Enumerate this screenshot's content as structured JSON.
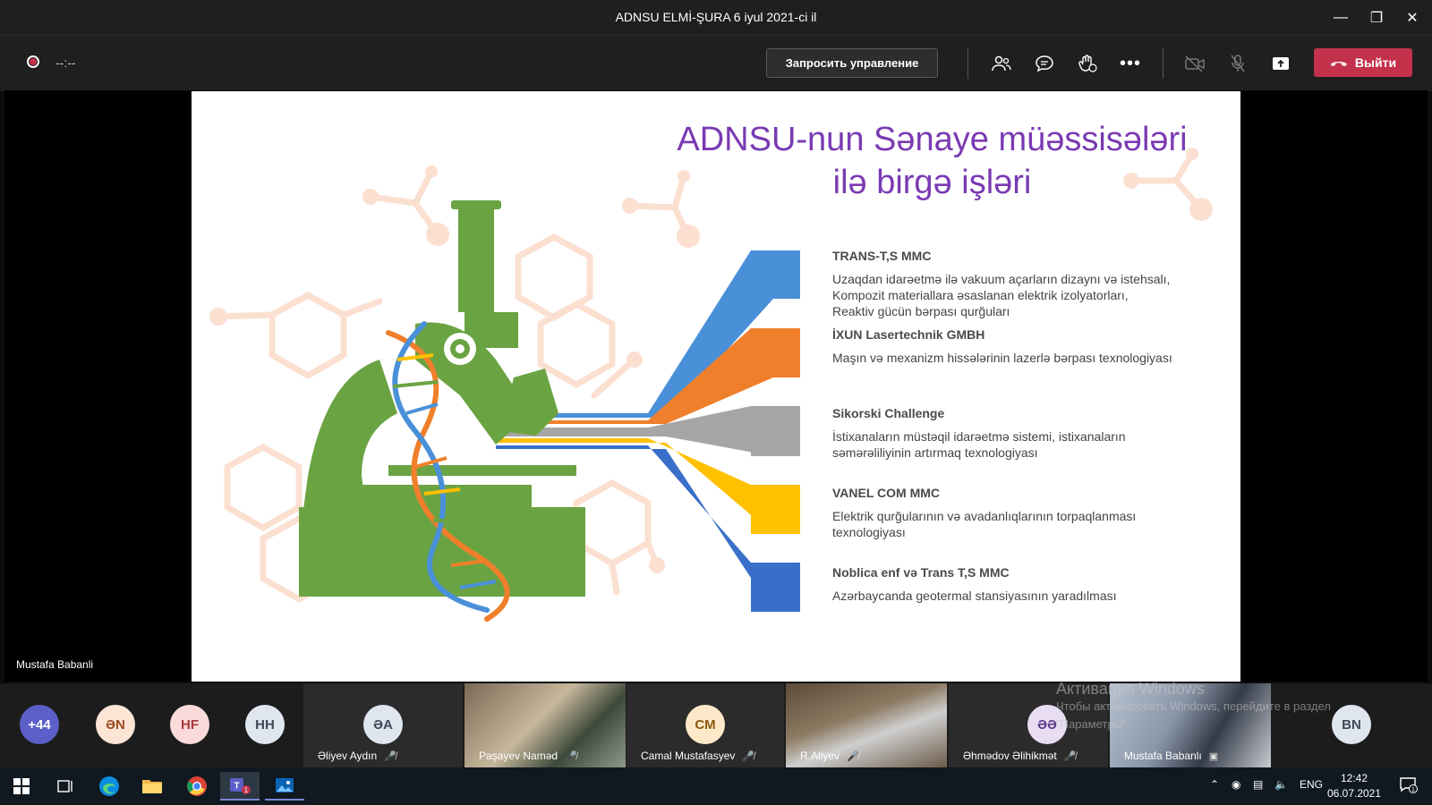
{
  "window": {
    "title": "ADNSU ELMİ-ŞURA 6 iyul 2021-ci il"
  },
  "toolbar": {
    "timer": "--:--",
    "request_control": "Запросить управление",
    "leave": "Выйти"
  },
  "slide": {
    "title_line1": "ADNSU-nun Sənaye müəssisələri",
    "title_line2": "ilə birgə işləri",
    "companies": [
      {
        "name": "TRANS-T,S MMC",
        "desc": "Uzaqdan idarəetmə ilə vakuum açarların dizaynı və istehsalı, Kompozit materiallara əsaslanan elektrik izolyatorları, Reaktiv gücün bərpası qurğuları",
        "color": "#4a90d9"
      },
      {
        "name": "İXUN Lasertechnik GMBH",
        "desc": "Maşın və mexanizm hissələrinin lazerlə bərpası texnologiyası",
        "color": "#f07f2b"
      },
      {
        "name": "Sikorski Challenge",
        "desc": "İstixanaların müstəqil idarəetmə sistemi, istixanaların səmərəliliyinin artırmaq texnologiyası",
        "color": "#a6a6a6"
      },
      {
        "name": "VANEL COM MMC",
        "desc": "Elektrik qurğularının və avadanlıqlarının torpaqlanması texnologiyası",
        "color": "#ffc000"
      },
      {
        "name": "Noblica enf və Trans T,S MMC",
        "desc": "Azərbaycanda geotermal stansiyasının yaradılması",
        "color": "#3a6fc9"
      }
    ]
  },
  "presenter_label": "Mustafa Babanli",
  "participants": {
    "overflow": "+44",
    "avatars": [
      {
        "initials": "ƏN",
        "bg": "#fde5d6",
        "fg": "#9a4d1f"
      },
      {
        "initials": "HF",
        "bg": "#fbdada",
        "fg": "#a83a3a"
      },
      {
        "initials": "HH",
        "bg": "#dfe6ee",
        "fg": "#3f4a58"
      }
    ],
    "tiles": [
      {
        "initials": "ƏA",
        "name": "Əliyev Aydın",
        "bg": "#dfe6ee",
        "fg": "#3f4a58"
      },
      {
        "initials": "",
        "name": "Paşayev Naməd",
        "bg": "",
        "fg": ""
      },
      {
        "initials": "CM",
        "name": "Camal Mustafasyev",
        "bg": "#fde9c9",
        "fg": "#8a5a10"
      },
      {
        "initials": "",
        "name": "R.Aliyev",
        "bg": "",
        "fg": ""
      },
      {
        "initials": "ƏƏ",
        "name": "Əhmədov Əlihikmət",
        "bg": "#e8ddf3",
        "fg": "#5d3d8a"
      },
      {
        "initials": "",
        "name": "Mustafa Babanlı",
        "bg": "",
        "fg": ""
      }
    ],
    "last": {
      "initials": "BN"
    }
  },
  "watermark": {
    "line1": "Активация Windows",
    "line2": "Чтобы активировать Windows, перейдите в раздел",
    "line3": "\"Параметры\"."
  },
  "taskbar": {
    "lang": "ENG",
    "time": "12:42",
    "date": "06.07.2021",
    "teams_badge": "1",
    "notif_badge": "1"
  },
  "icons": [
    "record-icon",
    "participants-icon",
    "chat-icon",
    "reactions-icon",
    "more-icon",
    "camera-off-icon",
    "mic-off-icon",
    "share-icon",
    "phone-icon",
    "windows-start-icon",
    "task-view-icon",
    "edge-icon",
    "explorer-icon",
    "chrome-icon",
    "teams-icon",
    "photos-icon"
  ]
}
